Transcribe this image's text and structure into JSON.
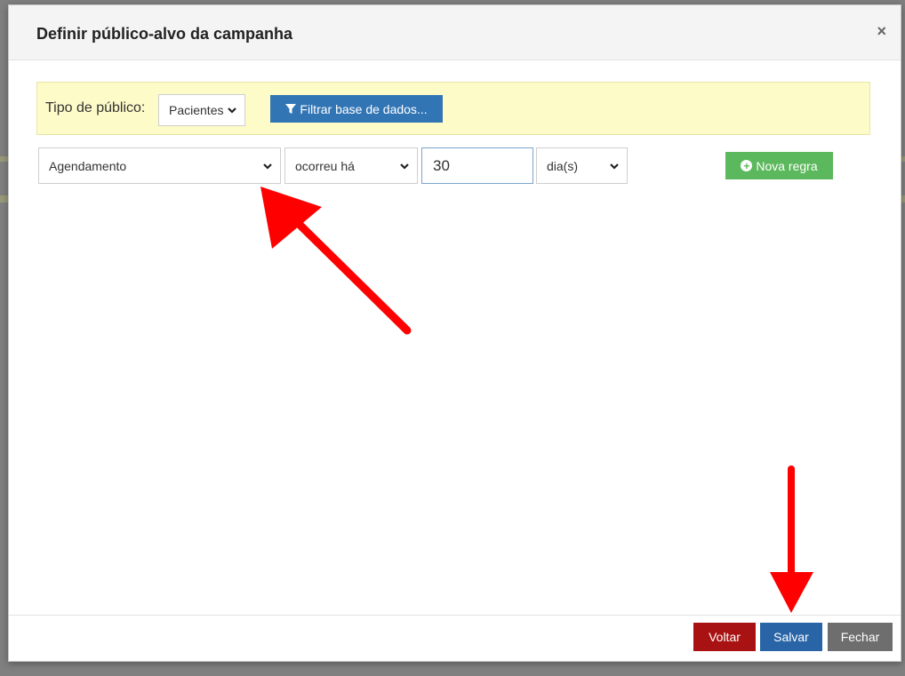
{
  "modal": {
    "title": "Definir público-alvo da campanha",
    "close_symbol": "×"
  },
  "filter_bar": {
    "label": "Tipo de público:",
    "audience_type": {
      "selected": "Pacientes"
    },
    "filter_button_label": "Filtrar base de dados...",
    "background_color": "#fdfbc8"
  },
  "rule": {
    "event": {
      "selected": "Agendamento"
    },
    "condition": {
      "selected": "ocorreu há"
    },
    "amount": {
      "value": "30"
    },
    "unit": {
      "selected": "dia(s)"
    },
    "new_rule_label": "Nova regra"
  },
  "footer": {
    "voltar_label": "Voltar",
    "salvar_label": "Salvar",
    "fechar_label": "Fechar"
  },
  "colors": {
    "primary": "#3275b5",
    "success": "#5cb85c",
    "danger": "#a91212",
    "save": "#2864a6",
    "secondary": "#6e6e6e",
    "annotation_arrow": "#ff0000"
  },
  "icons": {
    "close": "close-icon",
    "filter": "filter-icon",
    "chevron": "chevron-down-icon",
    "plus_circle": "plus-circle-icon"
  }
}
